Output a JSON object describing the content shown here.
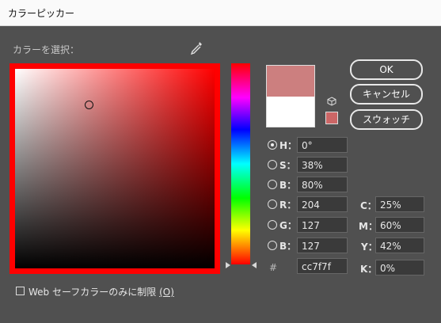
{
  "window": {
    "title": "カラーピッカー"
  },
  "picker": {
    "section_label": "カラーを選択："
  },
  "buttons": {
    "ok": "OK",
    "cancel": "キャンセル",
    "swatches": "スウォッチ"
  },
  "colors": {
    "new_color": "#cc7f7f",
    "old_color": "#ffffff",
    "hue_color": "#ff0000",
    "websafe_color": "#cc6666"
  },
  "fields": {
    "hsb": [
      {
        "label": "H：",
        "value": "0°",
        "selected": true
      },
      {
        "label": "S：",
        "value": "38%",
        "selected": false
      },
      {
        "label": "B：",
        "value": "80%",
        "selected": false
      }
    ],
    "rgb": [
      {
        "label": "R：",
        "value": "204",
        "selected": false
      },
      {
        "label": "G：",
        "value": "127",
        "selected": false
      },
      {
        "label": "B：",
        "value": "127",
        "selected": false
      }
    ],
    "hex": {
      "label": "#",
      "value": "cc7f7f"
    },
    "cmyk": [
      {
        "label": "C：",
        "value": "25%"
      },
      {
        "label": "M：",
        "value": "60%"
      },
      {
        "label": "Y：",
        "value": "42%"
      },
      {
        "label": "K：",
        "value": "0%"
      }
    ]
  },
  "websafe_only": {
    "label": "Web セーフカラーのみに制限",
    "shortcut": "(O)",
    "checked": false
  }
}
